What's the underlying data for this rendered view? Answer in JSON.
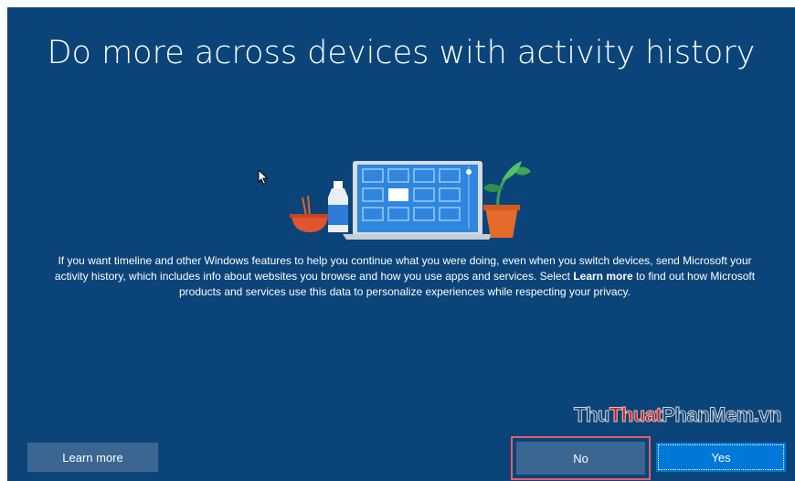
{
  "page": {
    "title": "Do more across devices with activity history",
    "body": {
      "part1": "If you want timeline and other Windows features to help you continue what you were doing, even when you switch devices, send Microsoft your activity history, which includes info about websites you browse and how you use apps and services. Select ",
      "bold": "Learn more",
      "part2": " to find out how Microsoft products and services use this data to personalize experiences while respecting your privacy."
    }
  },
  "buttons": {
    "learn_more": "Learn more",
    "no": "No",
    "yes": "Yes"
  },
  "watermark": {
    "part1": "Thu",
    "part2": "Thuat",
    "part3": "PhanMem",
    "part4": ".vn"
  },
  "colors": {
    "background": "#0b4479",
    "button": "#3a6691",
    "primary_button": "#0078d7",
    "highlight_outline": "#e35d6a"
  },
  "icons": {
    "illustration": "laptop-with-plant-and-bottle",
    "cursor": "mouse-pointer-icon"
  }
}
